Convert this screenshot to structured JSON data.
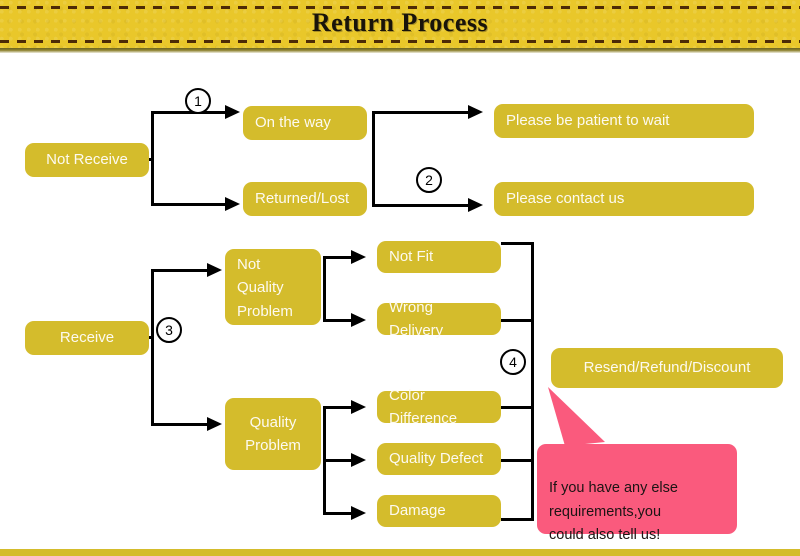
{
  "header": {
    "title": "Return Process",
    "banner_color": "#e9c72a",
    "dash_color": "#4d2b06"
  },
  "theme": {
    "node_color": "#d4bc2c",
    "node_text_color": "#fdfaf0",
    "connector_color": "#000000",
    "callout_color": "#fa5a7d",
    "background": "#ffffff"
  },
  "flow": {
    "branch_not_receive": {
      "root": "Not Receive",
      "marker": "1",
      "stages": [
        {
          "state": "On the way",
          "outcome": "Please be patient to wait"
        },
        {
          "state": "Returned/Lost",
          "outcome": "Please contact us"
        }
      ],
      "outcome_marker": "2"
    },
    "branch_receive": {
      "root": "Receive",
      "marker": "3",
      "categories": [
        {
          "name": "Not\nQuality\nProblem",
          "reasons": [
            "Not Fit",
            "Wrong Delivery"
          ]
        },
        {
          "name": "Quality\nProblem",
          "reasons": [
            "Color Difference",
            "Quality Defect",
            "Damage"
          ]
        }
      ],
      "resolution_marker": "4",
      "resolution": "Resend/Refund/Discount"
    }
  },
  "callout": {
    "text": "If you have any else\nrequirements,you\ncould also tell us!"
  }
}
